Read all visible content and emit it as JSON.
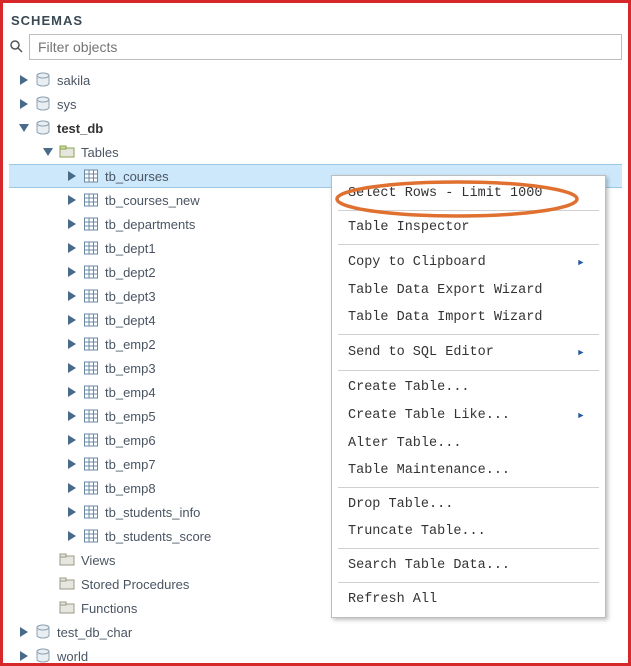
{
  "panel": {
    "title": "SCHEMAS"
  },
  "search": {
    "placeholder": "Filter objects"
  },
  "tree": {
    "sakila": "sakila",
    "sys": "sys",
    "test_db": "test_db",
    "tables": "Tables",
    "table_items": {
      "tb_courses": "tb_courses",
      "tb_courses_new": "tb_courses_new",
      "tb_departments": "tb_departments",
      "tb_dept1": "tb_dept1",
      "tb_dept2": "tb_dept2",
      "tb_dept3": "tb_dept3",
      "tb_dept4": "tb_dept4",
      "tb_emp2": "tb_emp2",
      "tb_emp3": "tb_emp3",
      "tb_emp4": "tb_emp4",
      "tb_emp5": "tb_emp5",
      "tb_emp6": "tb_emp6",
      "tb_emp7": "tb_emp7",
      "tb_emp8": "tb_emp8",
      "tb_students_info": "tb_students_info",
      "tb_students_score": "tb_students_score"
    },
    "views": "Views",
    "stored_procedures": "Stored Procedures",
    "functions": "Functions",
    "test_db_char": "test_db_char",
    "world": "world"
  },
  "context_menu": {
    "select_rows": "Select Rows - Limit 1000",
    "table_inspector": "Table Inspector",
    "copy_clipboard": "Copy to Clipboard",
    "export_wizard": "Table Data Export Wizard",
    "import_wizard": "Table Data Import Wizard",
    "send_sql": "Send to SQL Editor",
    "create_table": "Create Table...",
    "create_like": "Create Table Like...",
    "alter_table": "Alter Table...",
    "table_maint": "Table Maintenance...",
    "drop_table": "Drop Table...",
    "truncate": "Truncate Table...",
    "search_data": "Search Table Data...",
    "refresh_all": "Refresh All"
  }
}
